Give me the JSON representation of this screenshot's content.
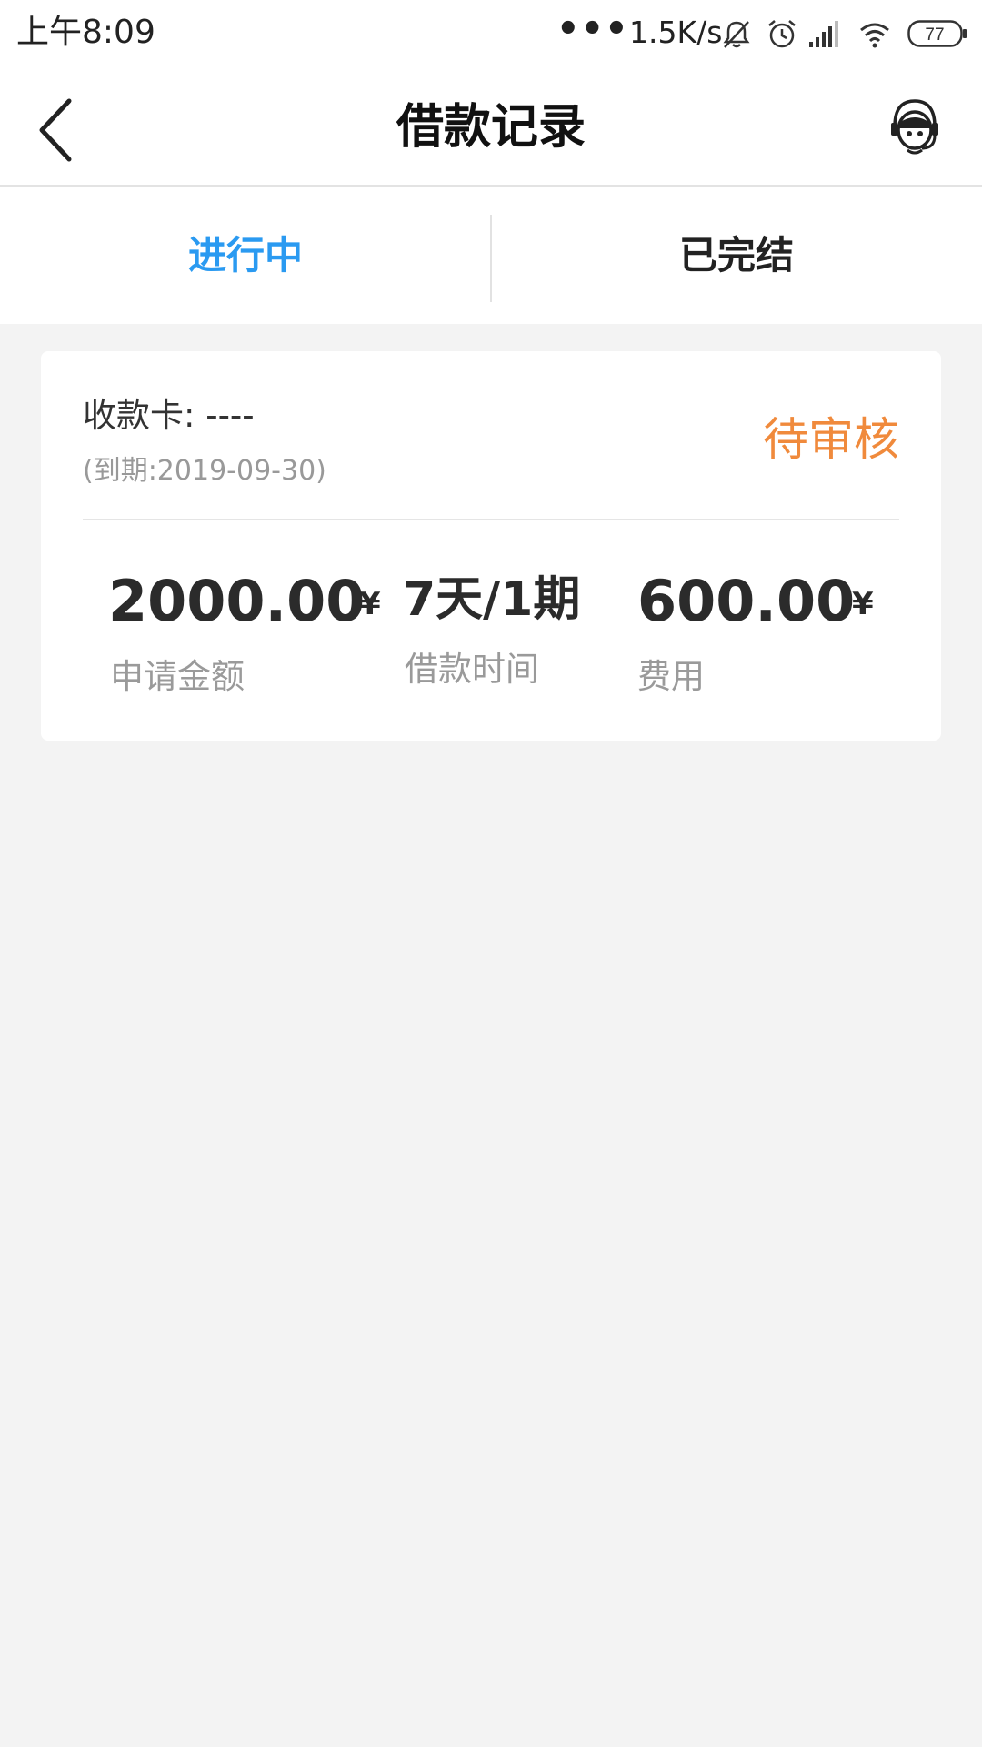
{
  "status_bar": {
    "time": "上午8:09",
    "dots": "•••",
    "speed": "1.5K/s",
    "battery": "77",
    "icons": [
      "mute-bell-icon",
      "alarm-icon",
      "signal-icon",
      "wifi-icon",
      "battery-icon"
    ]
  },
  "header": {
    "title": "借款记录",
    "back_icon": "chevron-left-icon",
    "support_icon": "customer-service-icon"
  },
  "tabs": [
    {
      "label": "进行中",
      "active": true
    },
    {
      "label": "已完结",
      "active": false
    }
  ],
  "colors": {
    "accent": "#2a9af1",
    "status_pending": "#f08a3c",
    "background": "#f3f3f3"
  },
  "loan_card": {
    "receive_card": "收款卡: ----",
    "due": "(到期:2019-09-30)",
    "status": "待审核",
    "amount": {
      "value": "2000.00",
      "currency": "¥",
      "label": "申请金额"
    },
    "term": {
      "value": "7天/1期",
      "label": "借款时间"
    },
    "fee": {
      "value": "600.00",
      "currency": "¥",
      "label": "费用"
    }
  }
}
